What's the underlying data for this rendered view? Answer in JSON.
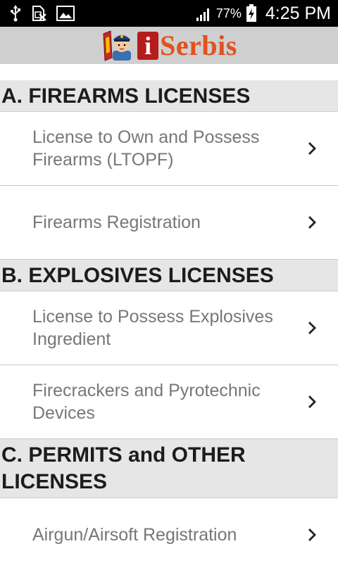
{
  "status_bar": {
    "icons": [
      "usb-icon",
      "no-sim-icon",
      "image-icon",
      "signal-icon",
      "battery-charging-icon"
    ],
    "battery_percent": "77%",
    "time": "4:25 PM"
  },
  "header": {
    "logo_i": "i",
    "logo_text": "Serbis",
    "colors": {
      "logo_red": "#b51c1c",
      "logo_orange": "#e0521f",
      "header_bg": "#cfcfcf"
    }
  },
  "sections": [
    {
      "title": "A. FIREARMS LICENSES",
      "items": [
        {
          "label": "License to Own and Possess Firearms (LTOPF)"
        },
        {
          "label": "Firearms Registration"
        }
      ]
    },
    {
      "title": "B. EXPLOSIVES LICENSES",
      "items": [
        {
          "label": "License to Possess Explosives Ingredient"
        },
        {
          "label": "Firecrackers and Pyrotechnic Devices"
        }
      ]
    },
    {
      "title": "C. PERMITS and OTHER LICENSES",
      "items": [
        {
          "label": "Airgun/Airsoft Registration"
        }
      ]
    }
  ],
  "icons": {
    "item_arrow": "chevron-right-icon"
  }
}
